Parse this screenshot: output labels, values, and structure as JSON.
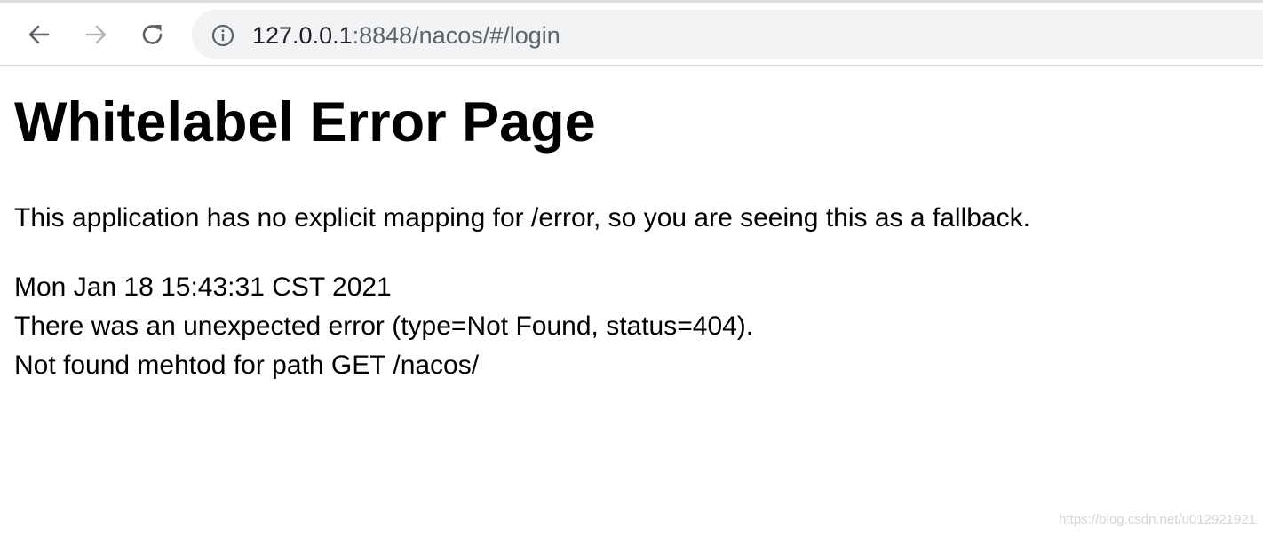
{
  "browser": {
    "url_host": "127.0.0.1",
    "url_rest": ":8848/nacos/#/login",
    "icons": {
      "back": "back-arrow-icon",
      "forward": "forward-arrow-icon",
      "reload": "reload-icon",
      "info": "info-icon"
    }
  },
  "page": {
    "title": "Whitelabel Error Page",
    "lead": "This application has no explicit mapping for /error, so you are seeing this as a fallback.",
    "timestamp": "Mon Jan 18 15:43:31 CST 2021",
    "error_line": "There was an unexpected error (type=Not Found, status=404).",
    "message": "Not found mehtod for path GET /nacos/"
  },
  "watermark": "https://blog.csdn.net/u012921921"
}
